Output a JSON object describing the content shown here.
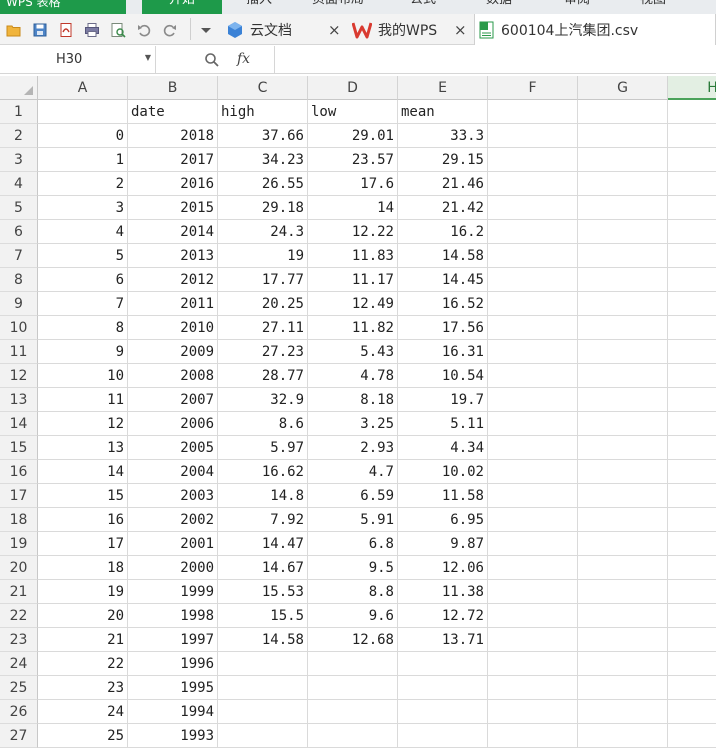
{
  "menubar": {
    "app_title": "WPS 表格",
    "items": [
      "开始",
      "插入",
      "页面布局",
      "公式",
      "数据",
      "审阅",
      "视图"
    ]
  },
  "tabs": [
    {
      "label": "云文档",
      "icon": "cloud-cube-icon"
    },
    {
      "label": "我的WPS",
      "icon": "wps-logo-icon"
    },
    {
      "label": "600104上汽集团.csv",
      "icon": "spreadsheet-file-icon"
    }
  ],
  "toolbar_icons": [
    "open-folder-icon",
    "save-icon",
    "export-pdf-icon",
    "print-icon",
    "print-preview-icon",
    "undo-icon",
    "redo-icon",
    "dropdown-arrow-icon"
  ],
  "formula_bar": {
    "name_box": "H30",
    "fx_label": "fx",
    "formula": ""
  },
  "columns": [
    "A",
    "B",
    "C",
    "D",
    "E",
    "F",
    "G",
    "H"
  ],
  "selected_column": "H",
  "rows": [
    [
      "",
      "date",
      "high",
      "low",
      "mean"
    ],
    [
      "0",
      "2018",
      "37.66",
      "29.01",
      "33.3"
    ],
    [
      "1",
      "2017",
      "34.23",
      "23.57",
      "29.15"
    ],
    [
      "2",
      "2016",
      "26.55",
      "17.6",
      "21.46"
    ],
    [
      "3",
      "2015",
      "29.18",
      "14",
      "21.42"
    ],
    [
      "4",
      "2014",
      "24.3",
      "12.22",
      "16.2"
    ],
    [
      "5",
      "2013",
      "19",
      "11.83",
      "14.58"
    ],
    [
      "6",
      "2012",
      "17.77",
      "11.17",
      "14.45"
    ],
    [
      "7",
      "2011",
      "20.25",
      "12.49",
      "16.52"
    ],
    [
      "8",
      "2010",
      "27.11",
      "11.82",
      "17.56"
    ],
    [
      "9",
      "2009",
      "27.23",
      "5.43",
      "16.31"
    ],
    [
      "10",
      "2008",
      "28.77",
      "4.78",
      "10.54"
    ],
    [
      "11",
      "2007",
      "32.9",
      "8.18",
      "19.7"
    ],
    [
      "12",
      "2006",
      "8.6",
      "3.25",
      "5.11"
    ],
    [
      "13",
      "2005",
      "5.97",
      "2.93",
      "4.34"
    ],
    [
      "14",
      "2004",
      "16.62",
      "4.7",
      "10.02"
    ],
    [
      "15",
      "2003",
      "14.8",
      "6.59",
      "11.58"
    ],
    [
      "16",
      "2002",
      "7.92",
      "5.91",
      "6.95"
    ],
    [
      "17",
      "2001",
      "14.47",
      "6.8",
      "9.87"
    ],
    [
      "18",
      "2000",
      "14.67",
      "9.5",
      "12.06"
    ],
    [
      "19",
      "1999",
      "15.53",
      "8.8",
      "11.38"
    ],
    [
      "20",
      "1998",
      "15.5",
      "9.6",
      "12.72"
    ],
    [
      "21",
      "1997",
      "14.58",
      "12.68",
      "13.71"
    ],
    [
      "22",
      "1996",
      "",
      "",
      ""
    ],
    [
      "23",
      "1995",
      "",
      "",
      ""
    ],
    [
      "24",
      "1994",
      "",
      "",
      ""
    ],
    [
      "25",
      "1993",
      "",
      "",
      ""
    ]
  ]
}
